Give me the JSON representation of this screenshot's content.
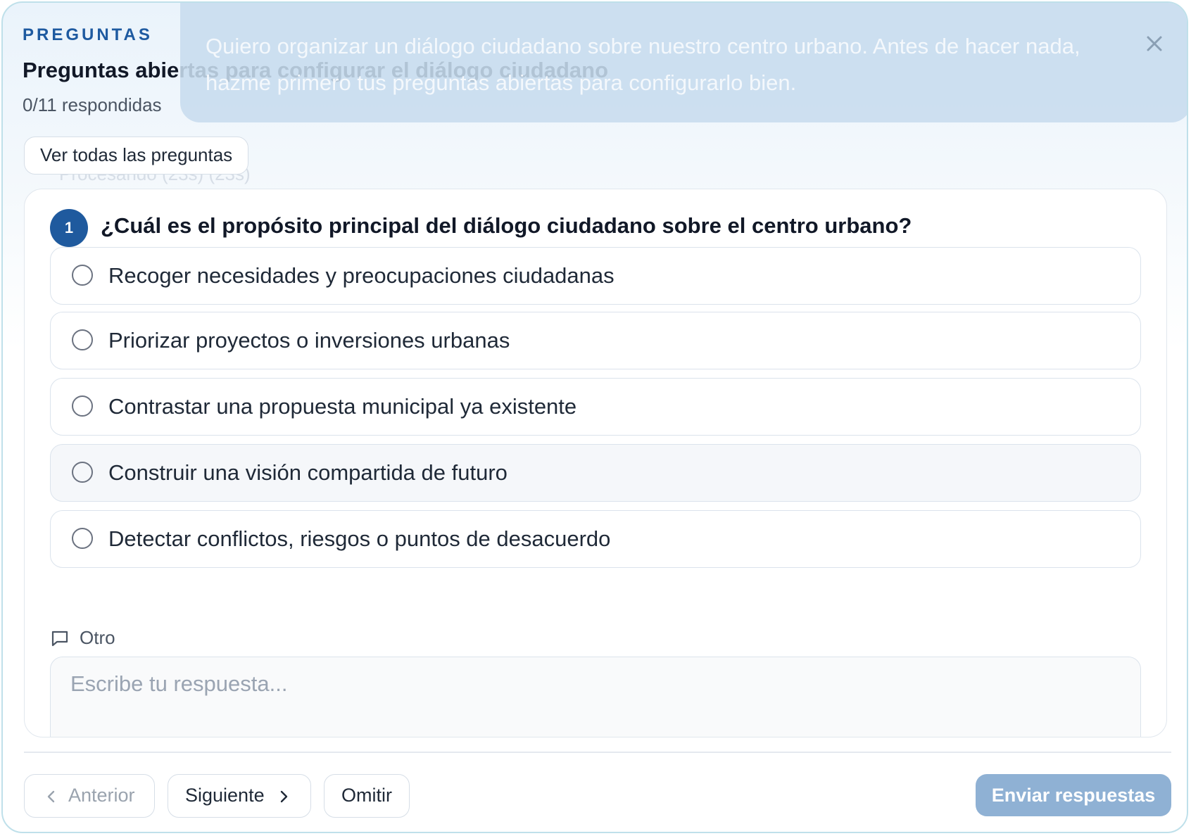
{
  "header": {
    "kicker": "PREGUNTAS",
    "title": "Preguntas abiertas para configurar el diálogo ciudadano",
    "progress": "0/11 respondidas",
    "see_all_label": "Ver todas las preguntas",
    "ghost_status": "Procesando (23s) (23s)"
  },
  "prompt_overlay": {
    "text": "Quiero organizar un diálogo ciudadano sobre nuestro centro urbano. Antes de hacer nada, hazme primero tus preguntas abiertas para configurarlo bien.",
    "close_icon": "close-icon"
  },
  "question": {
    "number": "1",
    "text": "¿Cuál es el propósito principal del diálogo ciudadano sobre el centro urbano?",
    "options": [
      {
        "label": "Recoger necesidades y preocupaciones ciudadanas"
      },
      {
        "label": "Priorizar proyectos o inversiones urbanas"
      },
      {
        "label": "Contrastar una propuesta municipal ya existente"
      },
      {
        "label": "Construir una visión compartida de futuro"
      },
      {
        "label": "Detectar conflictos, riesgos o puntos de desacuerdo"
      }
    ],
    "other_label": "Otro",
    "other_placeholder": "Escribe tu respuesta..."
  },
  "footer": {
    "prev_label": "Anterior",
    "next_label": "Siguiente",
    "skip_label": "Omitir",
    "submit_label": "Enviar respuestas"
  },
  "colors": {
    "accent": "#1f5a9e",
    "submit_disabled": "#8fb1d4",
    "overlay": "#c7dcee"
  }
}
